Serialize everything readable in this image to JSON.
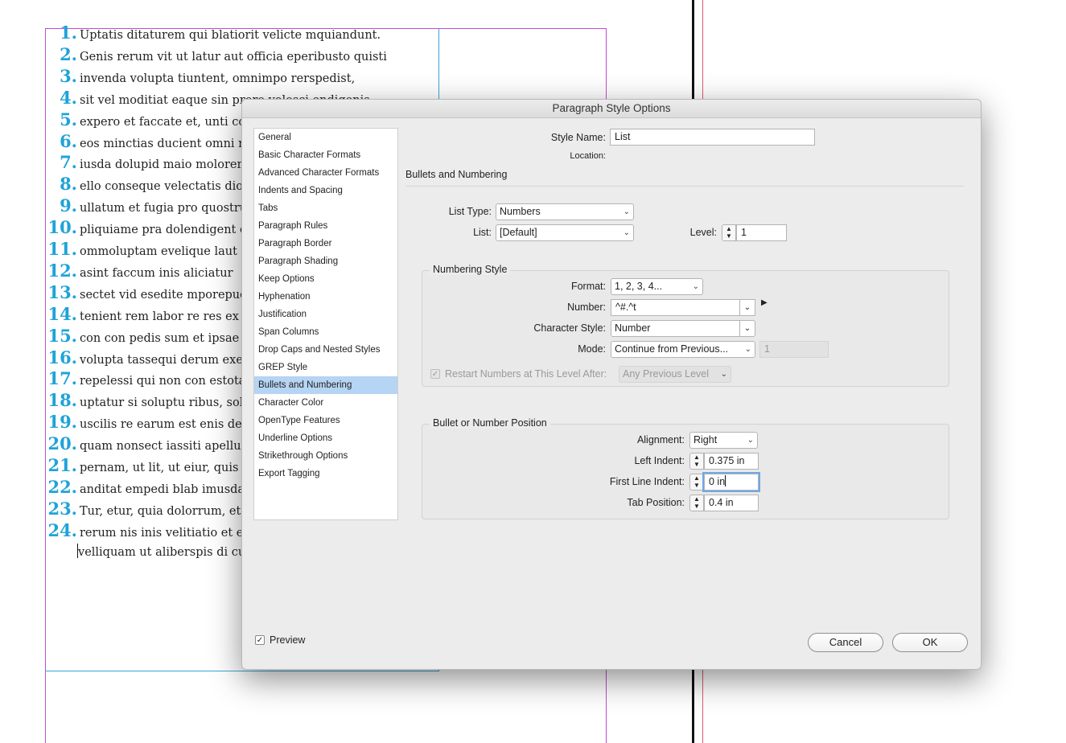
{
  "document": {
    "numbered_lines": [
      {
        "num": "1.",
        "text": "Uptatis ditaturem qui blatiorit velicte mquiandunt."
      },
      {
        "num": "2.",
        "text": "Genis rerum vit ut latur aut officia eperibusto quisti"
      },
      {
        "num": "3.",
        "text": "invenda volupta tiuntent, omnimpo rerspedist,"
      },
      {
        "num": "4.",
        "text": "sit vel moditiat eaque sin prore volesci endigenis"
      },
      {
        "num": "5.",
        "text": "expero et faccate et, unti comm"
      },
      {
        "num": "6.",
        "text": "eos minctias ducient omni rese"
      },
      {
        "num": "7.",
        "text": "iusda dolupid maio molorem n"
      },
      {
        "num": "8.",
        "text": "ello conseque velectatis dione"
      },
      {
        "num": "9.",
        "text": "ullatum et fugia pro quostrum"
      },
      {
        "num": "10.",
        "text": "pliquiame pra dolendigent exp"
      },
      {
        "num": "11.",
        "text": "ommoluptam evelique laut ape"
      },
      {
        "num": "12.",
        "text": "asint faccum inis aliciatur"
      },
      {
        "num": "13.",
        "text": "sectet vid esedite mporepudar"
      },
      {
        "num": "14.",
        "text": "tenient rem labor re res ex exp"
      },
      {
        "num": "15.",
        "text": "con con pedis sum et ipsae pos"
      },
      {
        "num": "16.",
        "text": "volupta tassequi derum exerum"
      },
      {
        "num": "17.",
        "text": "repelessi qui non con estotatir"
      },
      {
        "num": "18.",
        "text": "uptatur si soluptu ribus, solupt"
      },
      {
        "num": "19.",
        "text": "uscilis re earum est enis dessin"
      },
      {
        "num": "20.",
        "text": "quam nonsect iassiti apellupid"
      },
      {
        "num": "21.",
        "text": "pernam, ut lit, ut eiur, quis as a"
      },
      {
        "num": "22.",
        "text": "anditat empedi blab imusdand"
      },
      {
        "num": "23.",
        "text": "Tur, etur, quia dolorrum, et et c"
      },
      {
        "num": "24.",
        "text": "rerum nis inis velitiatio et esci"
      }
    ],
    "trailing_line": "velliquam ut aliberspis di cum c"
  },
  "dialog": {
    "title": "Paragraph Style Options",
    "sidebar": [
      "General",
      "Basic Character Formats",
      "Advanced Character Formats",
      "Indents and Spacing",
      "Tabs",
      "Paragraph Rules",
      "Paragraph Border",
      "Paragraph Shading",
      "Keep Options",
      "Hyphenation",
      "Justification",
      "Span Columns",
      "Drop Caps and Nested Styles",
      "GREP Style",
      "Bullets and Numbering",
      "Character Color",
      "OpenType Features",
      "Underline Options",
      "Strikethrough Options",
      "Export Tagging"
    ],
    "selected_sidebar_index": 14,
    "style_name_label": "Style Name:",
    "style_name_value": "List",
    "location_label": "Location:",
    "section_title": "Bullets and Numbering",
    "list_type_label": "List Type:",
    "list_type_value": "Numbers",
    "list_label": "List:",
    "list_value": "[Default]",
    "level_label": "Level:",
    "level_value": "1",
    "numbering_style": {
      "title": "Numbering Style",
      "format_label": "Format:",
      "format_value": "1, 2, 3, 4...",
      "number_label": "Number:",
      "number_value": "^#.^t",
      "char_style_label": "Character Style:",
      "char_style_value": "Number",
      "mode_label": "Mode:",
      "mode_value": "Continue from Previous...",
      "mode_start_value": "1",
      "restart_label": "Restart Numbers at This Level After:",
      "restart_value": "Any Previous Level"
    },
    "position": {
      "title": "Bullet or Number Position",
      "alignment_label": "Alignment:",
      "alignment_value": "Right",
      "left_indent_label": "Left Indent:",
      "left_indent_value": "0.375 in",
      "first_line_label": "First Line Indent:",
      "first_line_value": "0 in",
      "tab_position_label": "Tab Position:",
      "tab_position_value": "0.4 in"
    },
    "preview_label": "Preview",
    "cancel_label": "Cancel",
    "ok_label": "OK"
  }
}
